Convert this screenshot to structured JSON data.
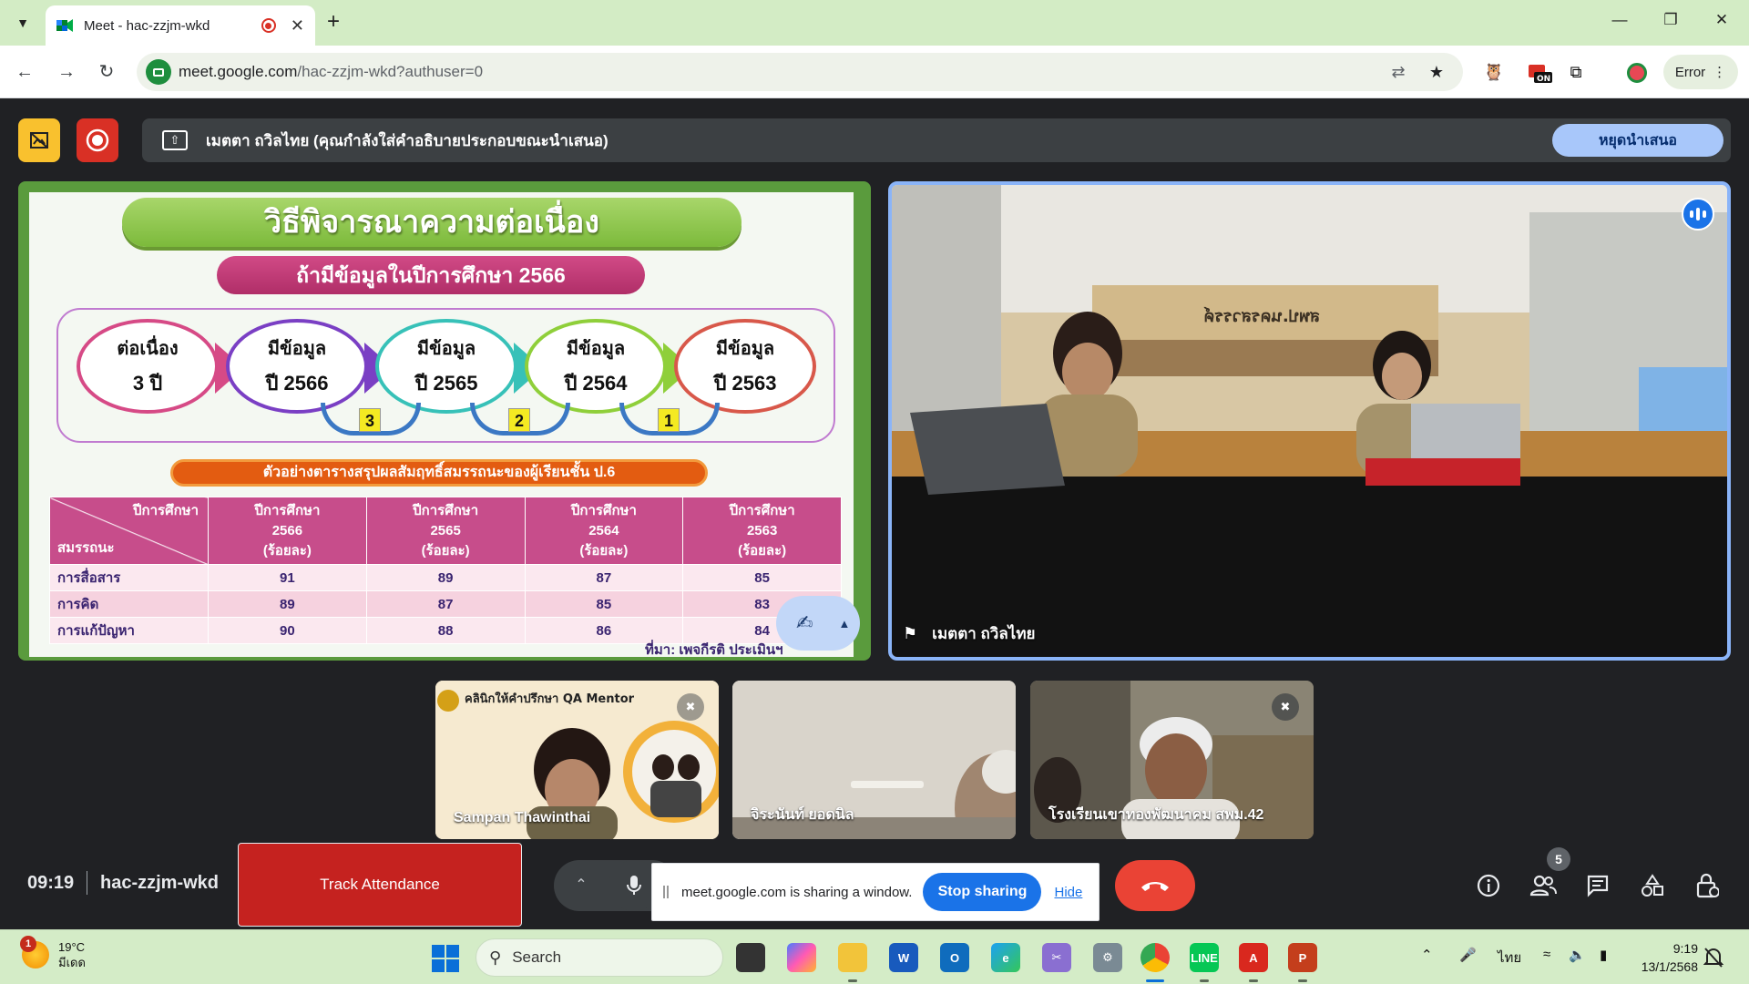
{
  "browser": {
    "tab_title": "Meet - hac-zzjm-wkd",
    "url_host": "meet.google.com",
    "url_path": "/hac-zzjm-wkd?authuser=0",
    "profile_label": "Error"
  },
  "presenting": {
    "label": "เมตตา ถวิลไทย (คุณกำลังใส่คำอธิบายประกอบขณะนำเสนอ)",
    "stop_button": "หยุดนำเสนอ"
  },
  "slide": {
    "title": "วิธีพิจารณาความต่อเนื่อง",
    "subtitle": "ถ้ามีข้อมูลในปีการศึกษา 2566",
    "ovals": [
      {
        "line1": "ต่อเนื่อง",
        "line2": "3 ปี",
        "color": "#d64a86"
      },
      {
        "line1": "มีข้อมูล",
        "line2": "ปี 2566",
        "color": "#7a3fc4"
      },
      {
        "line1": "มีข้อมูล",
        "line2": "ปี 2565",
        "color": "#37c1b8"
      },
      {
        "line1": "มีข้อมูล",
        "line2": "ปี 2564",
        "color": "#8fcf3a"
      },
      {
        "line1": "มีข้อมูล",
        "line2": "ปี 2563",
        "color": "#d8584a"
      }
    ],
    "badges": [
      "3",
      "2",
      "1"
    ],
    "example_label": "ตัวอย่างตารางสรุปผลสัมฤทธิ์สมรรถนะของผู้เรียนชั้น ป.6",
    "table": {
      "corner_top": "ปีการศึกษา",
      "corner_bottom": "สมรรถนะ",
      "columns": [
        {
          "line1": "ปีการศึกษา",
          "line2": "2566",
          "line3": "(ร้อยละ)"
        },
        {
          "line1": "ปีการศึกษา",
          "line2": "2565",
          "line3": "(ร้อยละ)"
        },
        {
          "line1": "ปีการศึกษา",
          "line2": "2564",
          "line3": "(ร้อยละ)"
        },
        {
          "line1": "ปีการศึกษา",
          "line2": "2563",
          "line3": "(ร้อยละ)"
        }
      ],
      "rows": [
        {
          "label": "การสื่อสาร",
          "values": [
            "91",
            "89",
            "87",
            "85"
          ]
        },
        {
          "label": "การคิด",
          "values": [
            "89",
            "87",
            "85",
            "83"
          ]
        },
        {
          "label": "การแก้ปัญหา",
          "values": [
            "90",
            "88",
            "86",
            "84"
          ]
        }
      ]
    },
    "footer": "ที่มา: เพจกีรติ ประเมินฯ"
  },
  "main_camera": {
    "name": "เมตตา ถวิลไทย",
    "sign_text": "สพป.นครสวรรค์"
  },
  "participants": [
    {
      "name": "Sampan Thawinthai",
      "banner_title": "คลินิกให้คำปรึกษา QA Mentor"
    },
    {
      "name": "จิระนันท์ ยอดนิล"
    },
    {
      "name": "โรงเรียนเขาทองพัฒนาคม สพม.42"
    }
  ],
  "controls": {
    "time": "09:19",
    "meeting_code": "hac-zzjm-wkd",
    "track_attendance": "Track Attendance",
    "share_message": "meet.google.com is sharing a window.",
    "stop_sharing": "Stop sharing",
    "hide": "Hide",
    "people_count": "5"
  },
  "taskbar": {
    "weather_badge": "1",
    "temperature": "19°C",
    "weather_desc": "มีเดด",
    "search_label": "Search",
    "language": "ไทย",
    "time": "9:19",
    "date": "13/1/2568"
  }
}
